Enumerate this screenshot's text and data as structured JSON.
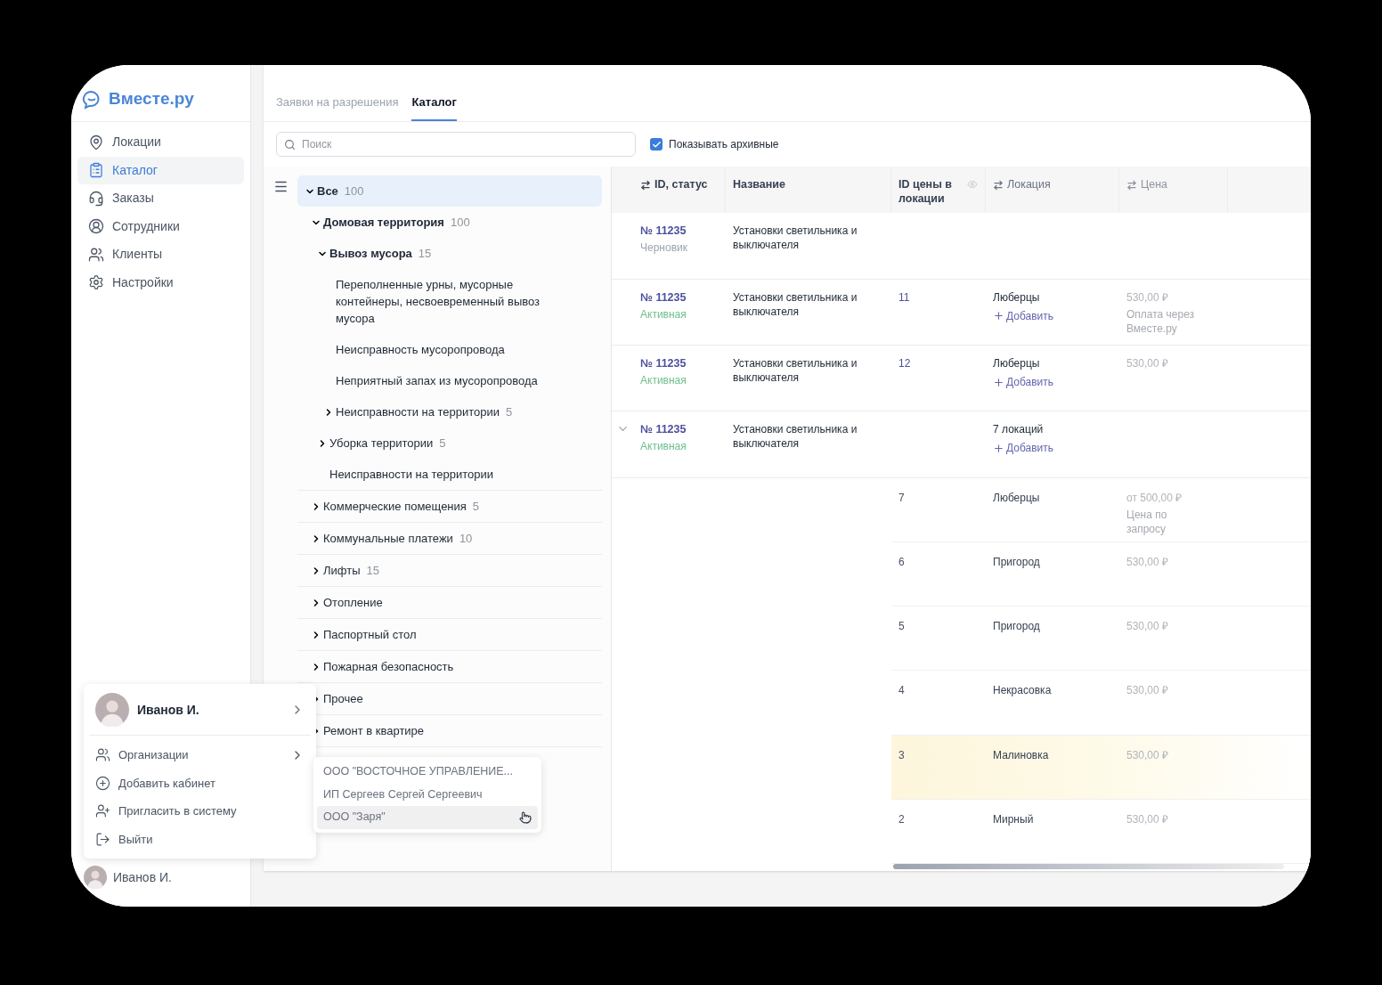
{
  "logo": "Вместе.ру",
  "nav": [
    {
      "label": "Локации",
      "selected": false
    },
    {
      "label": "Каталог",
      "selected": true
    },
    {
      "label": "Заказы",
      "selected": false
    },
    {
      "label": "Сотрудники",
      "selected": false
    },
    {
      "label": "Клиенты",
      "selected": false
    },
    {
      "label": "Настройки",
      "selected": false
    }
  ],
  "user": {
    "name": "Иванов И."
  },
  "user_menu": {
    "name": "Иванов И.",
    "items": [
      {
        "label": "Организации",
        "submenu": true
      },
      {
        "label": "Добавить кабинет",
        "submenu": false
      },
      {
        "label": "Пригласить в систему",
        "submenu": false
      },
      {
        "label": "Выйти",
        "submenu": false
      }
    ]
  },
  "org_menu": [
    {
      "label": "ООО \"ВОСТОЧНОЕ УПРАВЛЕНИЕ...",
      "selected": false
    },
    {
      "label": "ИП Сергеев Сергей Сергеевич",
      "selected": false
    },
    {
      "label": "ООО \"Заря\"",
      "selected": true
    }
  ],
  "tabs": [
    {
      "label": "Заявки на разрешения",
      "selected": false
    },
    {
      "label": "Каталог",
      "selected": true
    }
  ],
  "search": {
    "placeholder": "Поиск"
  },
  "show_archived": {
    "label": "Показывать архивные",
    "checked": true
  },
  "tree": [
    {
      "label": "Все",
      "count": "100",
      "expanded": true,
      "selected": true,
      "children": [
        {
          "label": "Домовая территория",
          "count": "100",
          "expanded": true,
          "selected": false,
          "children": [
            {
              "label": "Вывоз мусора",
              "count": "15",
              "expanded": true,
              "selected": false,
              "children": [
                {
                  "label": "Переполненные урны, мусорные контейнеры, несвоевременный вывоз мусора",
                  "selected": false
                },
                {
                  "label": "Неисправность мусоропровода",
                  "selected": false
                },
                {
                  "label": "Неприятный запах из мусоропровода",
                  "selected": false
                },
                {
                  "label": "Неисправности на территории",
                  "count": "5",
                  "expanded": false,
                  "selected": false
                }
              ]
            },
            {
              "label": "Уборка территории",
              "count": "5",
              "expanded": false,
              "selected": false
            },
            {
              "label": "Неисправности на территории",
              "selected": false
            }
          ]
        },
        {
          "label": "Коммерческие помещения",
          "count": "5",
          "expanded": false,
          "selected": false
        },
        {
          "label": "Коммунальные платежи",
          "count": "10",
          "expanded": false,
          "selected": false
        },
        {
          "label": "Лифты",
          "count": "15",
          "expanded": false,
          "selected": false
        },
        {
          "label": "Отопление",
          "expanded": false,
          "selected": false
        },
        {
          "label": "Паспортный стол",
          "expanded": false,
          "selected": false
        },
        {
          "label": "Пожарная безопасность",
          "expanded": false,
          "selected": false
        },
        {
          "label": "Прочее",
          "expanded": false,
          "selected": false
        },
        {
          "label": "Ремонт в квартире",
          "expanded": false,
          "selected": false
        }
      ]
    }
  ],
  "table": {
    "columns": [
      {
        "label": "ID, статус"
      },
      {
        "label": "Название"
      },
      {
        "label": "ID цены в локации"
      },
      {
        "label": "Локация"
      },
      {
        "label": "Цена"
      }
    ],
    "rows": [
      {
        "kind": "item",
        "expanded": false,
        "id": "№ 11235",
        "status": "Черновик",
        "color": "#9ca3af",
        "name": "Установки светильника и выключателя"
      },
      {
        "kind": "item",
        "expanded": false,
        "id": "№ 11235",
        "status": "Активная",
        "color": "#6fbf8f",
        "name": "Установки светильника и выключателя",
        "price_id": "11",
        "location": "Люберцы",
        "add": "Добавить",
        "price": "530,00 ₽",
        "note": "Оплата через Вместе.ру"
      },
      {
        "kind": "item",
        "expanded": false,
        "id": "№ 11235",
        "status": "Активная",
        "color": "#6fbf8f",
        "name": "Установки светильника и выключателя",
        "price_id": "12",
        "location": "Люберцы",
        "add": "Добавить",
        "price": "530,00 ₽"
      },
      {
        "kind": "item",
        "expanded": true,
        "id": "№ 11235",
        "status": "Активная",
        "color": "#6fbf8f",
        "name": "Установки светильника и выключателя",
        "location": "7 локаций",
        "add": "Добавить"
      },
      {
        "kind": "sub",
        "highlighted": false,
        "price_id": "7",
        "location": "Люберцы",
        "price": "от 500,00 ₽",
        "note": "Цена по запросу"
      },
      {
        "kind": "sub",
        "highlighted": false,
        "price_id": "6",
        "location": "Пригород",
        "price": "530,00 ₽"
      },
      {
        "kind": "sub",
        "highlighted": false,
        "price_id": "5",
        "location": "Пригород",
        "price": "530,00 ₽"
      },
      {
        "kind": "sub",
        "highlighted": false,
        "price_id": "4",
        "location": "Некрасовка",
        "price": "530,00 ₽"
      },
      {
        "kind": "sub",
        "highlighted": true,
        "price_id": "3",
        "location": "Малиновка",
        "price": "530,00 ₽"
      },
      {
        "kind": "sub",
        "highlighted": false,
        "price_id": "2",
        "location": "Мирный",
        "price": "530,00 ₽"
      }
    ]
  }
}
